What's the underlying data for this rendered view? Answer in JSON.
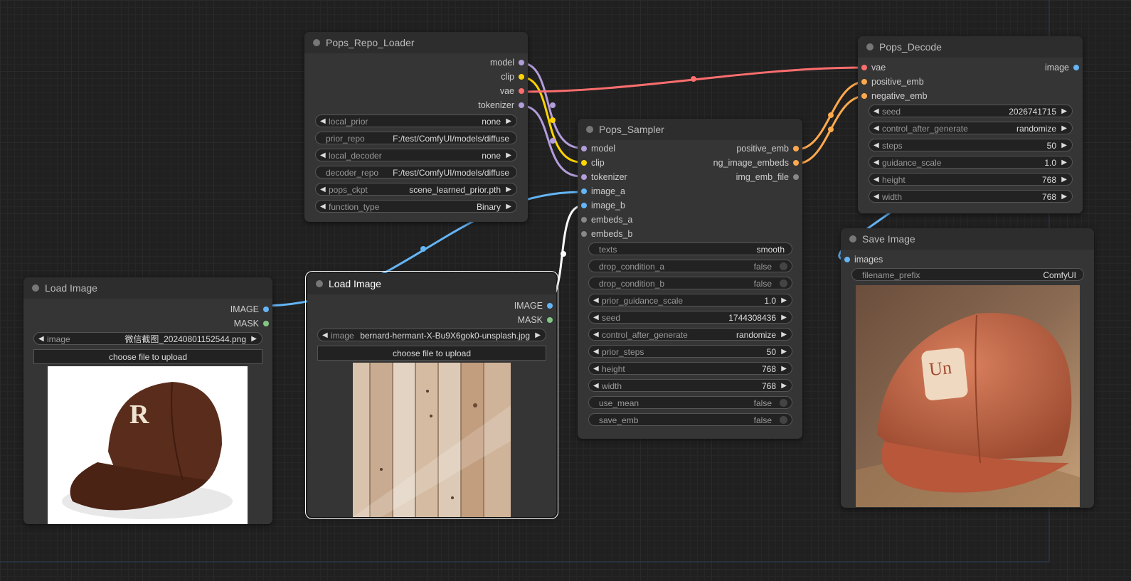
{
  "nodes": {
    "repo_loader": {
      "title": "Pops_Repo_Loader",
      "outputs": [
        "model",
        "clip",
        "vae",
        "tokenizer"
      ],
      "widgets": {
        "local_prior": {
          "label": "local_prior",
          "value": "none"
        },
        "prior_repo": {
          "label": "prior_repo",
          "value": "F:/test/ComfyUI/models/diffuse"
        },
        "local_decoder": {
          "label": "local_decoder",
          "value": "none"
        },
        "decoder_repo": {
          "label": "decoder_repo",
          "value": "F:/test/ComfyUI/models/diffuse"
        },
        "pops_ckpt": {
          "label": "pops_ckpt",
          "value": "scene_learned_prior.pth"
        },
        "function_type": {
          "label": "function_type",
          "value": "Binary"
        }
      }
    },
    "sampler": {
      "title": "Pops_Sampler",
      "inputs": [
        "model",
        "clip",
        "tokenizer",
        "image_a",
        "image_b",
        "embeds_a",
        "embeds_b"
      ],
      "outputs": [
        "positive_emb",
        "ng_image_embeds",
        "img_emb_file"
      ],
      "widgets": {
        "texts": {
          "label": "texts",
          "value": "smooth"
        },
        "drop_condition_a": {
          "label": "drop_condition_a",
          "value": "false"
        },
        "drop_condition_b": {
          "label": "drop_condition_b",
          "value": "false"
        },
        "prior_guidance_scale": {
          "label": "prior_guidance_scale",
          "value": "1.0"
        },
        "seed": {
          "label": "seed",
          "value": "1744308436"
        },
        "control_after_generate": {
          "label": "control_after_generate",
          "value": "randomize"
        },
        "prior_steps": {
          "label": "prior_steps",
          "value": "50"
        },
        "height": {
          "label": "height",
          "value": "768"
        },
        "width": {
          "label": "width",
          "value": "768"
        },
        "use_mean": {
          "label": "use_mean",
          "value": "false"
        },
        "save_emb": {
          "label": "save_emb",
          "value": "false"
        }
      }
    },
    "decode": {
      "title": "Pops_Decode",
      "inputs": [
        "vae",
        "positive_emb",
        "negative_emb"
      ],
      "outputs": [
        "image"
      ],
      "widgets": {
        "seed": {
          "label": "seed",
          "value": "2026741715"
        },
        "control_after_generate": {
          "label": "control_after_generate",
          "value": "randomize"
        },
        "steps": {
          "label": "steps",
          "value": "50"
        },
        "guidance_scale": {
          "label": "guidance_scale",
          "value": "1.0"
        },
        "height": {
          "label": "height",
          "value": "768"
        },
        "width": {
          "label": "width",
          "value": "768"
        }
      }
    },
    "save_image": {
      "title": "Save Image",
      "inputs": [
        "images"
      ],
      "widgets": {
        "filename_prefix": {
          "label": "filename_prefix",
          "value": "ComfyUI"
        }
      }
    },
    "load_image_1": {
      "title": "Load Image",
      "outputs": [
        "IMAGE",
        "MASK"
      ],
      "widgets": {
        "image": {
          "label": "image",
          "value": "微信截图_20240801152544.png"
        }
      },
      "upload_label": "choose file to upload"
    },
    "load_image_2": {
      "title": "Load Image",
      "outputs": [
        "IMAGE",
        "MASK"
      ],
      "widgets": {
        "image": {
          "label": "image",
          "value": "bernard-hermant-X-Bu9X6gok0-unsplash.jpg"
        }
      },
      "upload_label": "choose file to upload"
    }
  },
  "colors": {
    "model": "#b39ddb",
    "clip": "#ffd500",
    "vae": "#ff6e6e",
    "image": "#64b5f6",
    "embeds": "#ffa94d",
    "mask": "#81c784",
    "generic": "#888888",
    "link_white": "#ffffff"
  }
}
